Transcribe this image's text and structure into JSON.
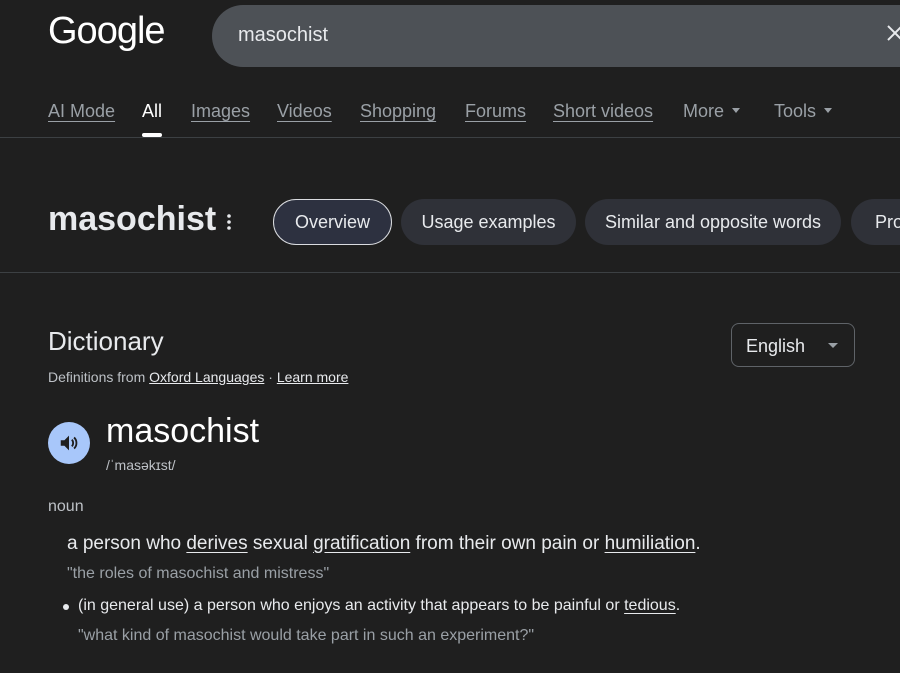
{
  "header": {
    "logo": "Google",
    "search_query": "masochist"
  },
  "tabs": [
    {
      "label": "AI Mode"
    },
    {
      "label": "All"
    },
    {
      "label": "Images"
    },
    {
      "label": "Videos"
    },
    {
      "label": "Shopping"
    },
    {
      "label": "Forums"
    },
    {
      "label": "Short videos"
    },
    {
      "label": "More"
    },
    {
      "label": "Tools"
    }
  ],
  "word_header": {
    "title": "masochist",
    "chips": [
      "Overview",
      "Usage examples",
      "Similar and opposite words",
      "Pro"
    ]
  },
  "dictionary": {
    "title": "Dictionary",
    "source_prefix": "Definitions from",
    "source_link": "Oxford Languages",
    "separator": "·",
    "learn_more": "Learn more",
    "language": "English",
    "headword": "masochist",
    "phonetic": "/ˈmasəkɪst/",
    "part_of_speech": "noun",
    "def1": {
      "p1": "a person who ",
      "w1": "derives",
      "p2": " sexual ",
      "w2": "gratification",
      "p3": " from their own pain or ",
      "w3": "humiliation",
      "p4": ".",
      "example": "\"the roles of masochist and mistress\""
    },
    "def2": {
      "p1": "(in general use) a person who enjoys an activity that appears to be painful or ",
      "w1": "tedious",
      "p2": ".",
      "example": "\"what kind of masochist would take part in such an experiment?\""
    }
  },
  "colors": {
    "background": "#1f1f1f",
    "search_box": "#4d5156",
    "chip_bg": "#2f3138",
    "speaker_bg": "#a8c7fa"
  }
}
